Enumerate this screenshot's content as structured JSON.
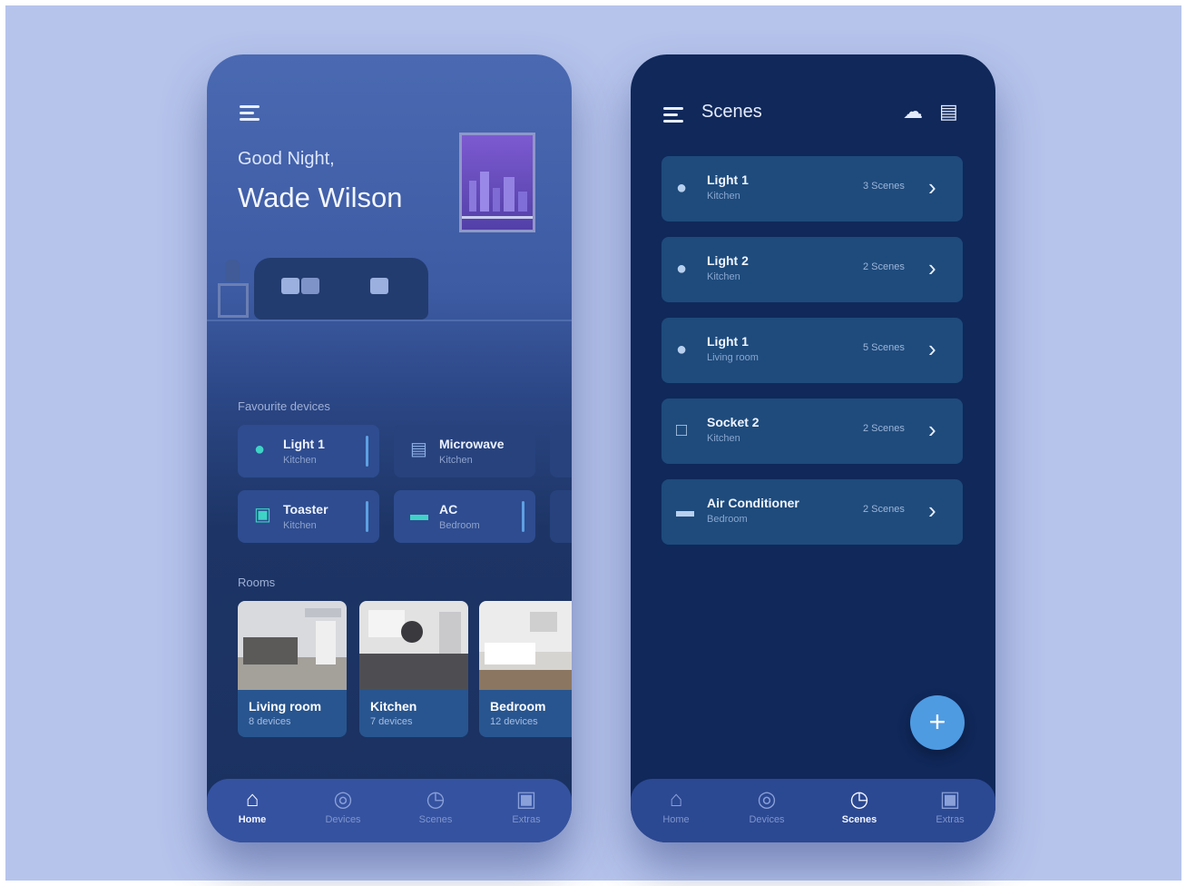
{
  "home": {
    "greeting": "Good Night,",
    "user_name": "Wade Wilson",
    "favourites_title": "Favourite devices",
    "devices": [
      {
        "name": "Light 1",
        "room": "Kitchen",
        "icon": "bulb-icon",
        "on": true,
        "color": "#3fd3c6"
      },
      {
        "name": "Microwave",
        "room": "Kitchen",
        "icon": "microwave-icon",
        "on": false,
        "color": "#8fb0e8"
      },
      {
        "name": "Toaster",
        "room": "Kitchen",
        "icon": "toaster-icon",
        "on": true,
        "color": "#3fd3c6"
      },
      {
        "name": "AC",
        "room": "Bedroom",
        "icon": "ac-icon",
        "on": true,
        "color": "#3fd3c6"
      }
    ],
    "rooms_title": "Rooms",
    "rooms": [
      {
        "name": "Living room",
        "devices": "8 devices"
      },
      {
        "name": "Kitchen",
        "devices": "7 devices"
      },
      {
        "name": "Bedroom",
        "devices": "12 devices"
      }
    ],
    "nav": [
      {
        "label": "Home",
        "icon": "home-icon",
        "active": true
      },
      {
        "label": "Devices",
        "icon": "devices-icon",
        "active": false
      },
      {
        "label": "Scenes",
        "icon": "clock-icon",
        "active": false
      },
      {
        "label": "Extras",
        "icon": "extras-icon",
        "active": false
      }
    ]
  },
  "scenes": {
    "title": "Scenes",
    "items": [
      {
        "name": "Light 1",
        "room": "Kitchen",
        "count": "3 Scenes",
        "icon": "bulb-icon"
      },
      {
        "name": "Light 2",
        "room": "Kitchen",
        "count": "2 Scenes",
        "icon": "bulb-icon"
      },
      {
        "name": "Light 1",
        "room": "Living room",
        "count": "5 Scenes",
        "icon": "bulb-icon"
      },
      {
        "name": "Socket 2",
        "room": "Kitchen",
        "count": "2 Scenes",
        "icon": "socket-icon"
      },
      {
        "name": "Air Conditioner",
        "room": "Bedroom",
        "count": "2 Scenes",
        "icon": "ac-icon"
      }
    ],
    "add_label": "+",
    "nav": [
      {
        "label": "Home",
        "icon": "home-icon",
        "active": false
      },
      {
        "label": "Devices",
        "icon": "devices-icon",
        "active": false
      },
      {
        "label": "Scenes",
        "icon": "clock-icon",
        "active": true
      },
      {
        "label": "Extras",
        "icon": "extras-icon",
        "active": false
      }
    ]
  },
  "colors": {
    "background": "#b6c4ec",
    "accent": "#4e9be2",
    "teal": "#3fd3c6"
  }
}
